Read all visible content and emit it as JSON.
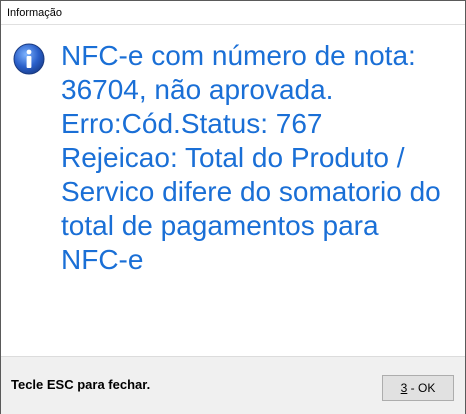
{
  "window": {
    "title": "Informação"
  },
  "message": {
    "text": "NFC-e com número de nota:\n36704, não aprovada.\nErro:Cód.Status: 767\nRejeicao: Total do Produto /\nServico difere do somatorio do\ntotal de pagamentos para\nNFC-e",
    "color": "#1a6fd6",
    "icon": "information-icon"
  },
  "footer": {
    "hint": "Tecle ESC para fechar.",
    "ok_button": {
      "hotkey": "3",
      "label": " - OK"
    }
  }
}
